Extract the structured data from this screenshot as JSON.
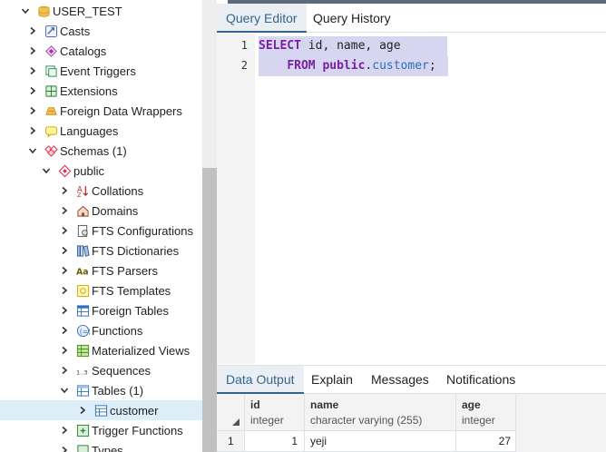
{
  "tree": {
    "items": [
      {
        "label": "USER_TEST",
        "icon": "database-icon",
        "chevron": "down"
      },
      {
        "label": "Casts",
        "icon": "casts-icon",
        "chevron": "right"
      },
      {
        "label": "Catalogs",
        "icon": "catalogs-icon",
        "chevron": "right"
      },
      {
        "label": "Event Triggers",
        "icon": "event-triggers-icon",
        "chevron": "right"
      },
      {
        "label": "Extensions",
        "icon": "extensions-icon",
        "chevron": "right"
      },
      {
        "label": "Foreign Data Wrappers",
        "icon": "foreign-data-wrappers-icon",
        "chevron": "right"
      },
      {
        "label": "Languages",
        "icon": "languages-icon",
        "chevron": "right"
      },
      {
        "label": "Schemas (1)",
        "icon": "schemas-icon",
        "chevron": "down"
      },
      {
        "label": "public",
        "icon": "schema-public-icon",
        "chevron": "down"
      },
      {
        "label": "Collations",
        "icon": "collations-icon",
        "chevron": "right"
      },
      {
        "label": "Domains",
        "icon": "domains-icon",
        "chevron": "right"
      },
      {
        "label": "FTS Configurations",
        "icon": "fts-configurations-icon",
        "chevron": "right"
      },
      {
        "label": "FTS Dictionaries",
        "icon": "fts-dictionaries-icon",
        "chevron": "right"
      },
      {
        "label": "FTS Parsers",
        "icon": "fts-parsers-icon",
        "chevron": "right",
        "icon_text": "Aa"
      },
      {
        "label": "FTS Templates",
        "icon": "fts-templates-icon",
        "chevron": "right"
      },
      {
        "label": "Foreign Tables",
        "icon": "foreign-tables-icon",
        "chevron": "right"
      },
      {
        "label": "Functions",
        "icon": "functions-icon",
        "chevron": "right"
      },
      {
        "label": "Materialized Views",
        "icon": "materialized-views-icon",
        "chevron": "right"
      },
      {
        "label": "Sequences",
        "icon": "sequences-icon",
        "chevron": "right",
        "icon_text": "1..3"
      },
      {
        "label": "Tables (1)",
        "icon": "tables-icon",
        "chevron": "down"
      },
      {
        "label": "customer",
        "icon": "table-icon",
        "chevron": "right",
        "selected": true
      },
      {
        "label": "Trigger Functions",
        "icon": "trigger-functions-icon",
        "chevron": "right"
      },
      {
        "label": "Types",
        "icon": "types-icon",
        "chevron": "right"
      }
    ]
  },
  "editor_tabs": [
    {
      "label": "Query Editor",
      "active": true
    },
    {
      "label": "Query History",
      "active": false
    }
  ],
  "editor": {
    "lines": [
      {
        "number": "1"
      },
      {
        "number": "2"
      }
    ]
  },
  "results_tabs": [
    {
      "label": "Data Output",
      "active": true
    },
    {
      "label": "Explain",
      "active": false
    },
    {
      "label": "Messages",
      "active": false
    },
    {
      "label": "Notifications",
      "active": false
    }
  ],
  "grid": {
    "columns": [
      {
        "name": "id",
        "type": "integer"
      },
      {
        "name": "name",
        "type": "character varying (255)"
      },
      {
        "name": "age",
        "type": "integer"
      }
    ],
    "rows": [
      {
        "row_number": "1",
        "cells": [
          "1",
          "yeji",
          "27"
        ]
      }
    ]
  },
  "colors": {
    "accent": "#326690",
    "selection": "#d6d6f0",
    "keyword": "#7a1fa2"
  }
}
